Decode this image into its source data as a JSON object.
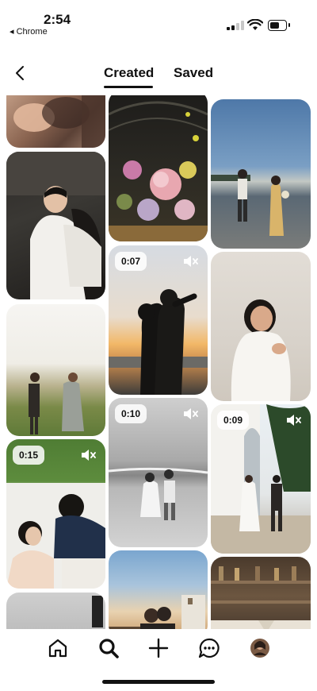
{
  "status_bar": {
    "time": "2:54",
    "back_app": "◂ Chrome"
  },
  "header": {
    "tabs": [
      {
        "label": "Created",
        "active": true
      },
      {
        "label": "Saved",
        "active": false
      }
    ]
  },
  "videos": {
    "couple_silhouette": "0:07",
    "beach_walk": "0:10",
    "church_couple": "0:09",
    "picnic_couple": "0:15"
  },
  "colors": {
    "accent": "#111111",
    "background": "#ffffff"
  },
  "bottom_nav": {
    "items": [
      "home-icon",
      "search-icon",
      "create-icon",
      "messages-icon",
      "profile-avatar"
    ]
  }
}
